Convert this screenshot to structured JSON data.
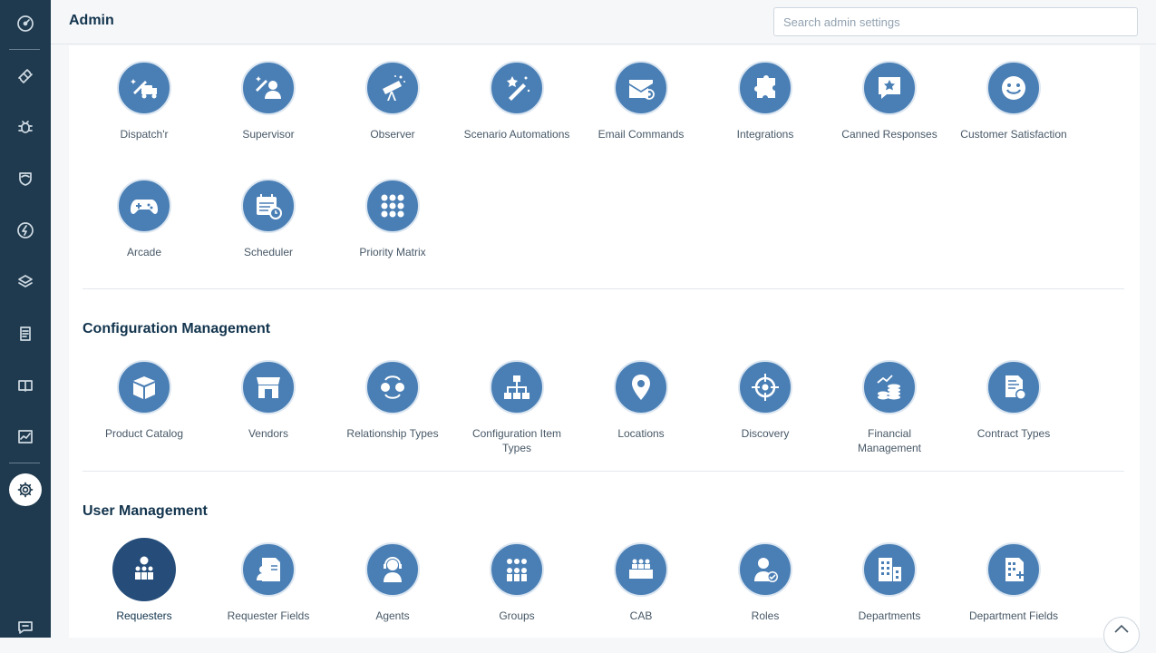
{
  "header": {
    "title": "Admin",
    "search_placeholder": "Search admin settings"
  },
  "sidebar": {
    "items": [
      {
        "icon": "dashboard-icon"
      },
      {
        "icon": "ticket-icon"
      },
      {
        "icon": "bug-icon"
      },
      {
        "icon": "shield-icon"
      },
      {
        "icon": "lightning-icon"
      },
      {
        "icon": "layers-icon"
      },
      {
        "icon": "notes-icon"
      },
      {
        "icon": "book-icon"
      },
      {
        "icon": "chart-icon"
      },
      {
        "icon": "gear-icon",
        "active": true
      },
      {
        "icon": "chat-icon"
      }
    ]
  },
  "sections": {
    "automation": {
      "tiles": [
        {
          "label": "Dispatch'r",
          "icon": "dispatchr-icon"
        },
        {
          "label": "Supervisor",
          "icon": "supervisor-icon"
        },
        {
          "label": "Observer",
          "icon": "telescope-icon"
        },
        {
          "label": "Scenario Automations",
          "icon": "magic-wand-icon"
        },
        {
          "label": "Email Commands",
          "icon": "email-icon"
        },
        {
          "label": "Integrations",
          "icon": "puzzle-icon"
        },
        {
          "label": "Canned Responses",
          "icon": "canned-response-icon"
        },
        {
          "label": "Customer Satisfaction",
          "icon": "smiley-icon"
        },
        {
          "label": "Arcade",
          "icon": "gamepad-icon"
        },
        {
          "label": "Scheduler",
          "icon": "calendar-clock-icon"
        },
        {
          "label": "Priority Matrix",
          "icon": "grid-dots-icon"
        }
      ]
    },
    "configuration": {
      "title": "Configuration Management",
      "tiles": [
        {
          "label": "Product Catalog",
          "icon": "box-icon"
        },
        {
          "label": "Vendors",
          "icon": "store-icon"
        },
        {
          "label": "Relationship Types",
          "icon": "relationship-icon"
        },
        {
          "label": "Configuration Item Types",
          "icon": "hierarchy-icon"
        },
        {
          "label": "Locations",
          "icon": "map-pin-icon"
        },
        {
          "label": "Discovery",
          "icon": "crosshair-icon"
        },
        {
          "label": "Financial Management",
          "icon": "coins-icon"
        },
        {
          "label": "Contract Types",
          "icon": "contract-icon"
        }
      ]
    },
    "users": {
      "title": "User Management",
      "tiles": [
        {
          "label": "Requesters",
          "icon": "requesters-icon",
          "selected": true
        },
        {
          "label": "Requester Fields",
          "icon": "requester-fields-icon"
        },
        {
          "label": "Agents",
          "icon": "headset-icon"
        },
        {
          "label": "Groups",
          "icon": "group-icon"
        },
        {
          "label": "CAB",
          "icon": "cab-icon"
        },
        {
          "label": "Roles",
          "icon": "role-icon"
        },
        {
          "label": "Departments",
          "icon": "building-icon"
        },
        {
          "label": "Department Fields",
          "icon": "department-fields-icon"
        }
      ]
    }
  }
}
